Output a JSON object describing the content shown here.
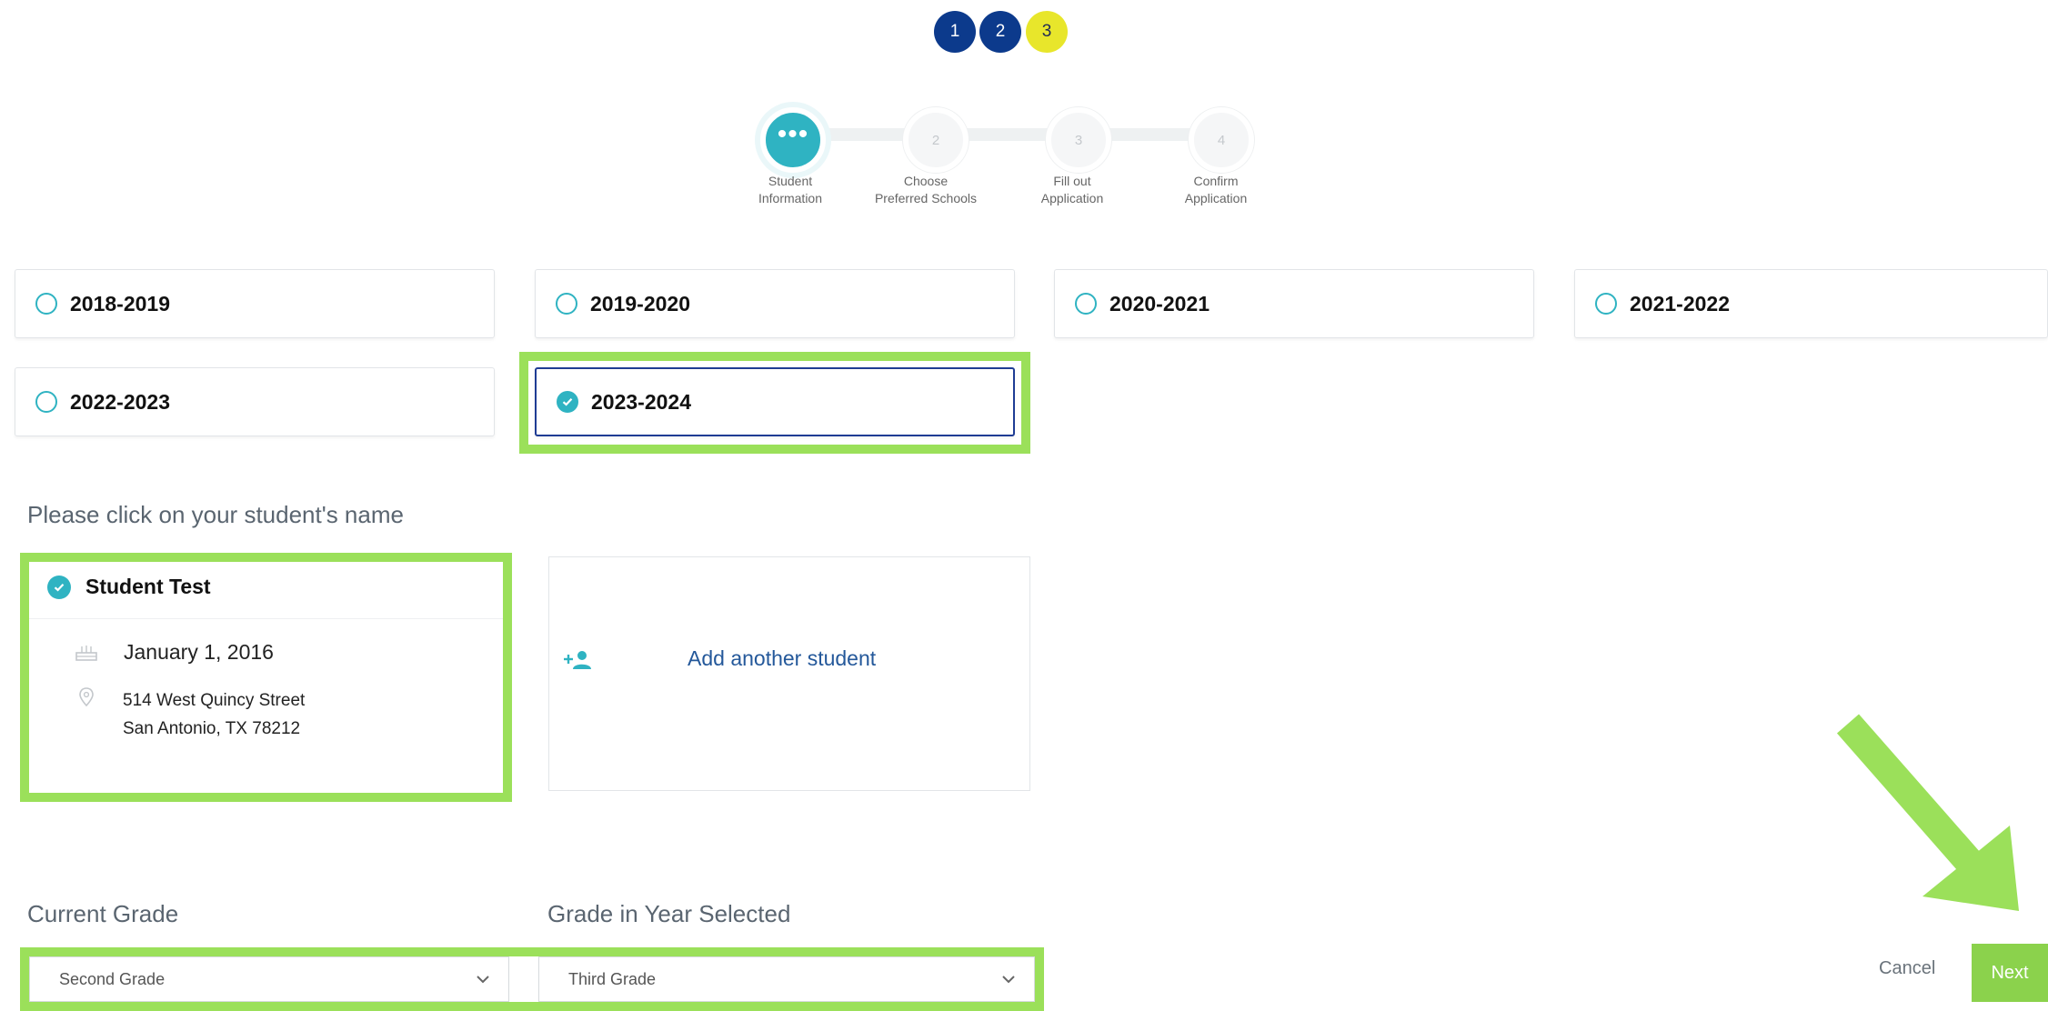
{
  "top_steps": [
    "1",
    "2",
    "3"
  ],
  "wizard": {
    "steps": [
      {
        "number": "...",
        "line1": "Student",
        "line2": "Information"
      },
      {
        "number": "2",
        "line1": "Choose",
        "line2": "Preferred Schools"
      },
      {
        "number": "3",
        "line1": "Fill out",
        "line2": "Application"
      },
      {
        "number": "4",
        "line1": "Confirm",
        "line2": "Application"
      }
    ],
    "active_index": 0
  },
  "years": [
    {
      "label": "2018-2019",
      "selected": false
    },
    {
      "label": "2019-2020",
      "selected": false
    },
    {
      "label": "2020-2021",
      "selected": false
    },
    {
      "label": "2021-2022",
      "selected": false
    },
    {
      "label": "2022-2023",
      "selected": false
    },
    {
      "label": "2023-2024",
      "selected": true
    }
  ],
  "student_prompt": "Please click on your student's name",
  "student": {
    "name": "Student Test",
    "birthdate": "January 1, 2016",
    "address_line1": "514 West Quincy Street",
    "address_line2": "San Antonio, TX 78212"
  },
  "add_student_label": "Add another student",
  "current_grade": {
    "label": "Current Grade",
    "value": "Second Grade"
  },
  "grade_in_year": {
    "label": "Grade in Year Selected",
    "value": "Third Grade"
  },
  "buttons": {
    "cancel": "Cancel",
    "next": "Next"
  },
  "colors": {
    "teal": "#2fb3c2",
    "navy": "#0c3a8c",
    "yellow": "#e8e62b",
    "highlight_green": "#9be05a",
    "next_green": "#8bd24c"
  }
}
